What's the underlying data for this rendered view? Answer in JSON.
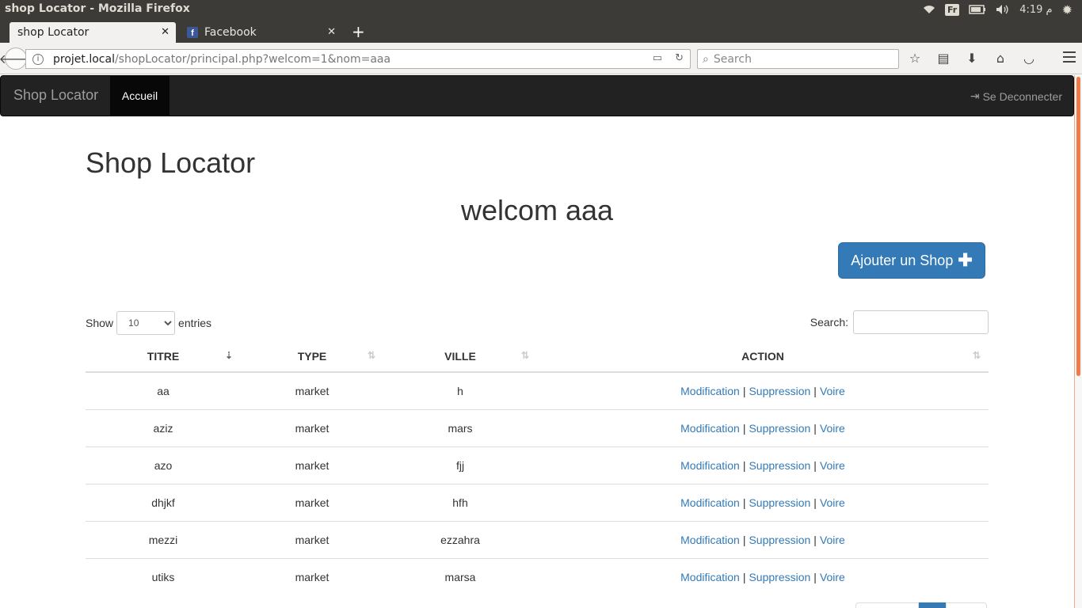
{
  "window": {
    "title": "shop Locator - Mozilla Firefox",
    "keyboard": "Fr",
    "clock": "4:19 م"
  },
  "tabs": [
    {
      "label": "shop Locator"
    },
    {
      "label": "Facebook"
    }
  ],
  "url": {
    "domain": "projet.local",
    "path": "/shopLocator/principal.php?welcom=1&nom=aaa"
  },
  "browser_search": {
    "placeholder": "Search"
  },
  "navbar": {
    "brand": "Shop Locator",
    "active_item": "Accueil",
    "logout": "Se Deconnecter"
  },
  "page": {
    "title": "Shop Locator",
    "welcome": "welcom aaa",
    "add_button": "Ajouter un Shop"
  },
  "datatable": {
    "show_label": "Show",
    "entries_value": "10",
    "entries_label": "entries",
    "search_label": "Search:",
    "columns": [
      "TITRE",
      "TYPE",
      "VILLE",
      "ACTION"
    ],
    "rows": [
      {
        "titre": "aa",
        "type": "market",
        "ville": "h"
      },
      {
        "titre": "aziz",
        "type": "market",
        "ville": "mars"
      },
      {
        "titre": "azo",
        "type": "market",
        "ville": "fjj"
      },
      {
        "titre": "dhjkf",
        "type": "market",
        "ville": "hfh"
      },
      {
        "titre": "mezzi",
        "type": "market",
        "ville": "ezzahra"
      },
      {
        "titre": "utiks",
        "type": "market",
        "ville": "marsa"
      }
    ],
    "actions": {
      "edit": "Modification",
      "delete": "Suppression",
      "view": "Voire",
      "separator": "|"
    }
  },
  "colors": {
    "primary": "#337ab7",
    "navbar": "#222222",
    "scroll_accent": "#ef7b4b"
  }
}
